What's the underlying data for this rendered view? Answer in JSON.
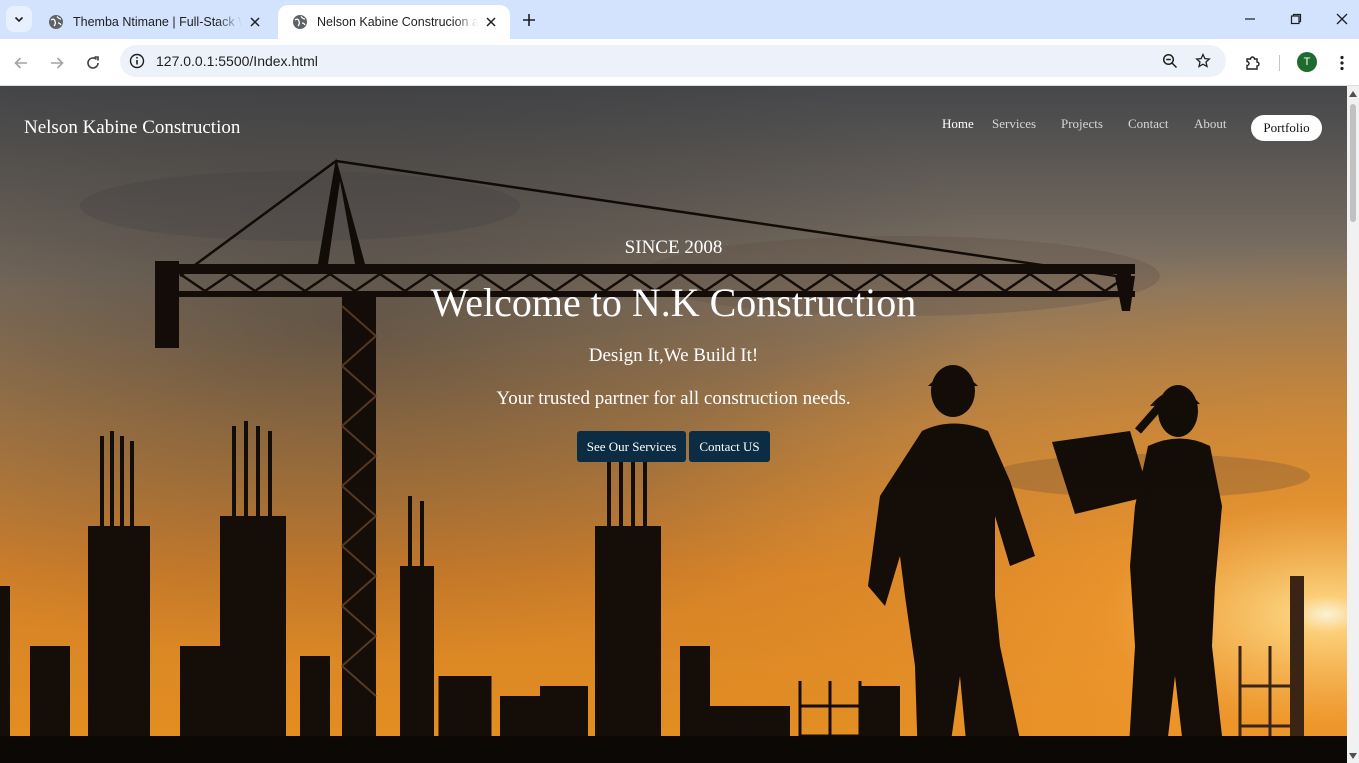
{
  "browser": {
    "tabs": [
      {
        "title": "Themba Ntimane | Full-Stack Web Developer",
        "active": false,
        "icon": "globe-icon"
      },
      {
        "title": "Nelson Kabine Construcion and Projects",
        "active": true,
        "icon": "globe-icon"
      }
    ],
    "url": "127.0.0.1:5500/Index.html",
    "profile_initial": "T",
    "colors": {
      "tabbar": "#d3e3fd",
      "omnibox": "#edf2fa",
      "avatar": "#1e6b2e"
    }
  },
  "site": {
    "brand": "Nelson Kabine Construction",
    "nav": [
      {
        "label": "Home",
        "current": true
      },
      {
        "label": "Services",
        "current": false
      },
      {
        "label": "Projects",
        "current": false
      },
      {
        "label": "Contact",
        "current": false
      },
      {
        "label": "About",
        "current": false
      }
    ],
    "portfolio_label": "Portfolio"
  },
  "hero": {
    "since": "SINCE 2008",
    "heading": "Welcome to N.K Construction",
    "tagline": "Design It,We Build It!",
    "subline": "Your trusted partner for all construction needs.",
    "buttons": {
      "services": "See Our Services",
      "contact": "Contact US"
    },
    "colors": {
      "button": "#0b2c42",
      "sky_top": "#5f6165",
      "sky_glow": "#f09a2c"
    }
  }
}
